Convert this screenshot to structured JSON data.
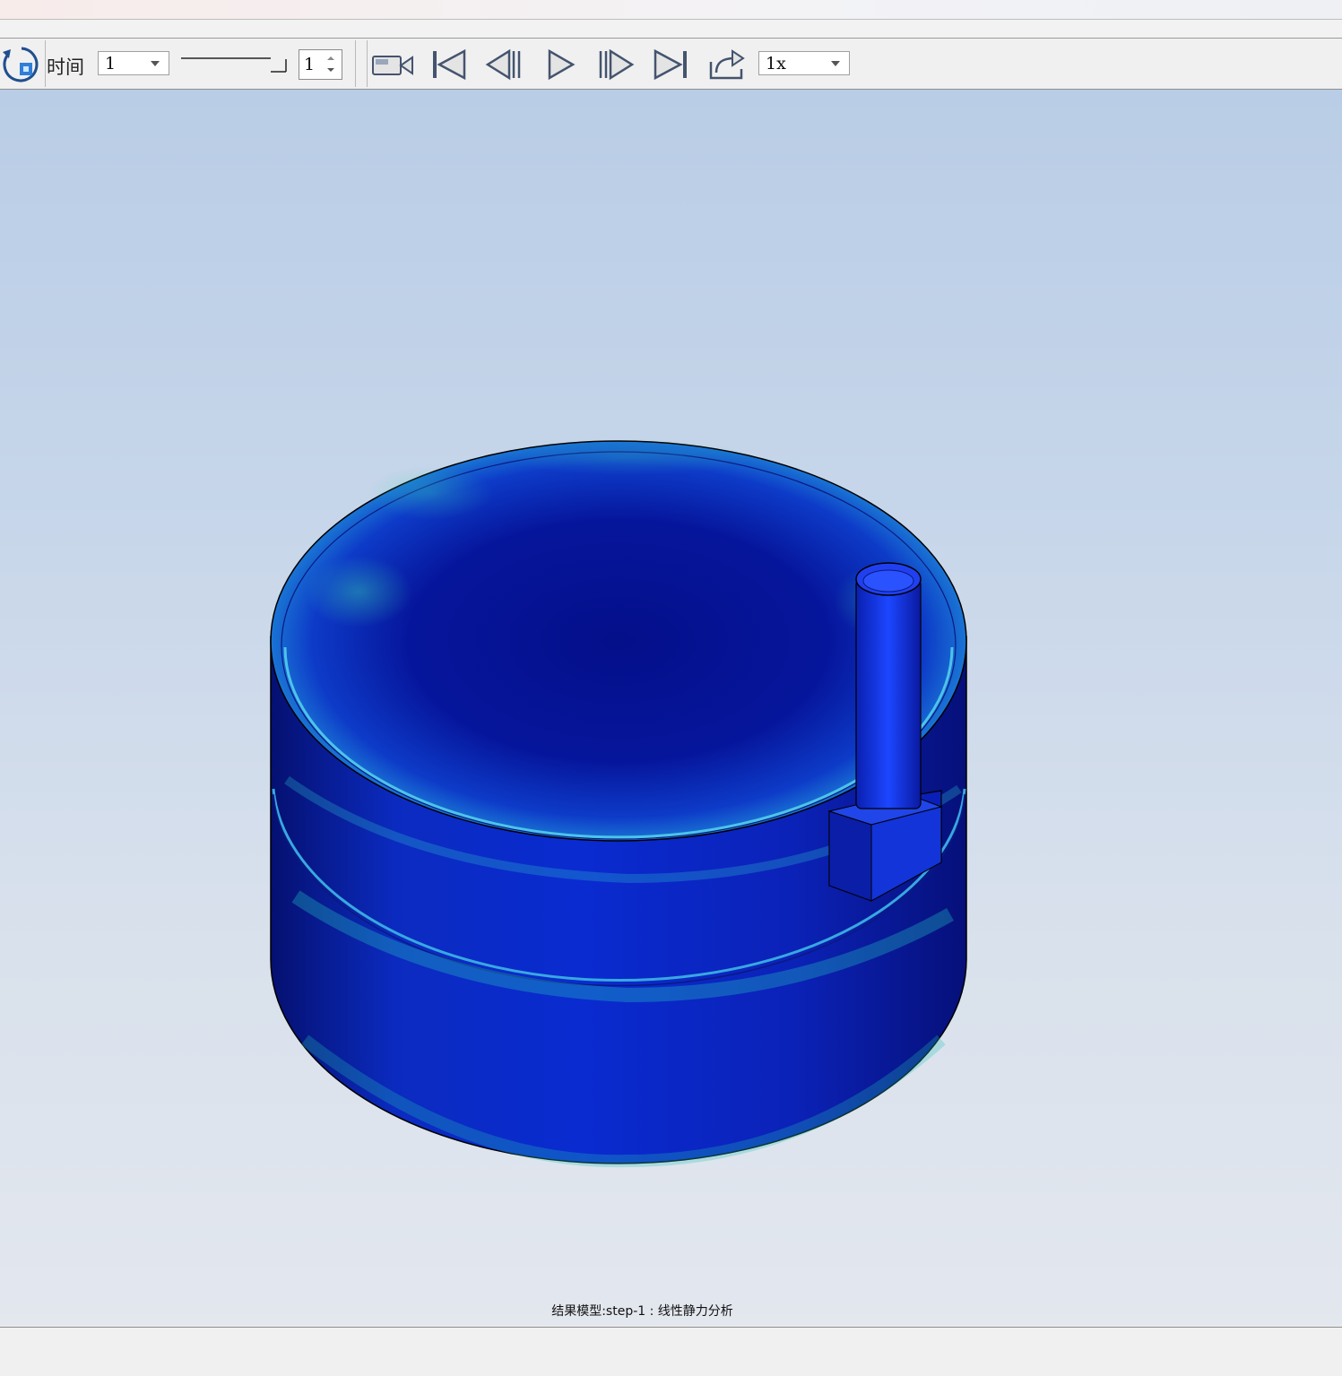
{
  "toolbar": {
    "time_label": "时间",
    "time_value": "1",
    "frame_value": "1",
    "speed_value": "1x",
    "icons": [
      "reset-view-icon",
      "record-video-icon",
      "first-frame-icon",
      "previous-frame-icon",
      "play-icon",
      "next-frame-icon",
      "last-frame-icon",
      "export-icon"
    ]
  },
  "viewport": {
    "caption": "结果模型:step-1 : 线性静力分析",
    "colors": {
      "stress_low": "#0a1a9e",
      "stress_mid": "#1f8fe0",
      "stress_high": "#35d66a",
      "background_top": "#b9cde6",
      "background_bottom": "#e3e7ee"
    }
  }
}
